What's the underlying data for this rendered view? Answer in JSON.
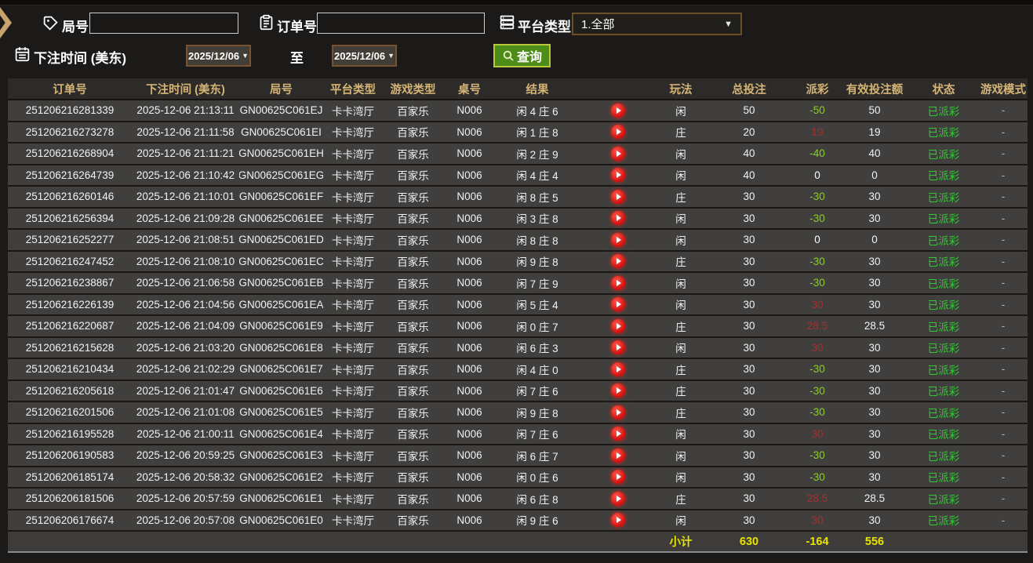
{
  "filters": {
    "game_no_label": "局号",
    "game_no_value": "",
    "order_no_label": "订单号",
    "order_no_value": "",
    "platform_type_label": "平台类型",
    "platform_type_value": "1.全部",
    "bet_time_label": "下注时间 (美东)",
    "date_from": "2025/12/06",
    "to_label": "至",
    "date_to": "2025/12/06",
    "query_label": "查询"
  },
  "colors": {
    "header_gold": "#d6b476",
    "payout_negative_green": "#8bd02a",
    "payout_positive_red": "#a42f2f",
    "status_green": "#2ecc31",
    "subtotal_yellow": "#e8e400",
    "query_button_green": "#4e8c1a",
    "play_button_red": "#d40d0d"
  },
  "table": {
    "headers": [
      "订单号",
      "下注时间 (美东)",
      "局号",
      "平台类型",
      "游戏类型",
      "桌号",
      "结果",
      "",
      "玩法",
      "总投注",
      "派彩",
      "有效投注额",
      "状态",
      "游戏模式"
    ],
    "rows": [
      {
        "order": "251206216281339",
        "time": "2025-12-06 21:13:11",
        "game": "GN00625C061EJ",
        "platform": "卡卡湾厅",
        "game_type": "百家乐",
        "table_no": "N006",
        "result": "闲 4 庄 6",
        "play": "闲",
        "bet": "50",
        "payout": "-50",
        "payout_state": "loss",
        "valid": "50",
        "status": "已派彩",
        "mode": "-"
      },
      {
        "order": "251206216273278",
        "time": "2025-12-06 21:11:58",
        "game": "GN00625C061EI",
        "platform": "卡卡湾厅",
        "game_type": "百家乐",
        "table_no": "N006",
        "result": "闲 1 庄 8",
        "play": "庄",
        "bet": "20",
        "payout": "19",
        "payout_state": "win",
        "valid": "19",
        "status": "已派彩",
        "mode": "-"
      },
      {
        "order": "251206216268904",
        "time": "2025-12-06 21:11:21",
        "game": "GN00625C061EH",
        "platform": "卡卡湾厅",
        "game_type": "百家乐",
        "table_no": "N006",
        "result": "闲 2 庄 9",
        "play": "闲",
        "bet": "40",
        "payout": "-40",
        "payout_state": "loss",
        "valid": "40",
        "status": "已派彩",
        "mode": "-"
      },
      {
        "order": "251206216264739",
        "time": "2025-12-06 21:10:42",
        "game": "GN00625C061EG",
        "platform": "卡卡湾厅",
        "game_type": "百家乐",
        "table_no": "N006",
        "result": "闲 4 庄 4",
        "play": "闲",
        "bet": "40",
        "payout": "0",
        "payout_state": "even",
        "valid": "0",
        "status": "已派彩",
        "mode": "-"
      },
      {
        "order": "251206216260146",
        "time": "2025-12-06 21:10:01",
        "game": "GN00625C061EF",
        "platform": "卡卡湾厅",
        "game_type": "百家乐",
        "table_no": "N006",
        "result": "闲 8 庄 5",
        "play": "庄",
        "bet": "30",
        "payout": "-30",
        "payout_state": "loss",
        "valid": "30",
        "status": "已派彩",
        "mode": "-"
      },
      {
        "order": "251206216256394",
        "time": "2025-12-06 21:09:28",
        "game": "GN00625C061EE",
        "platform": "卡卡湾厅",
        "game_type": "百家乐",
        "table_no": "N006",
        "result": "闲 3 庄 8",
        "play": "闲",
        "bet": "30",
        "payout": "-30",
        "payout_state": "loss",
        "valid": "30",
        "status": "已派彩",
        "mode": "-"
      },
      {
        "order": "251206216252277",
        "time": "2025-12-06 21:08:51",
        "game": "GN00625C061ED",
        "platform": "卡卡湾厅",
        "game_type": "百家乐",
        "table_no": "N006",
        "result": "闲 8 庄 8",
        "play": "闲",
        "bet": "30",
        "payout": "0",
        "payout_state": "even",
        "valid": "0",
        "status": "已派彩",
        "mode": "-"
      },
      {
        "order": "251206216247452",
        "time": "2025-12-06 21:08:10",
        "game": "GN00625C061EC",
        "platform": "卡卡湾厅",
        "game_type": "百家乐",
        "table_no": "N006",
        "result": "闲 9 庄 8",
        "play": "庄",
        "bet": "30",
        "payout": "-30",
        "payout_state": "loss",
        "valid": "30",
        "status": "已派彩",
        "mode": "-"
      },
      {
        "order": "251206216238867",
        "time": "2025-12-06 21:06:58",
        "game": "GN00625C061EB",
        "platform": "卡卡湾厅",
        "game_type": "百家乐",
        "table_no": "N006",
        "result": "闲 7 庄 9",
        "play": "闲",
        "bet": "30",
        "payout": "-30",
        "payout_state": "loss",
        "valid": "30",
        "status": "已派彩",
        "mode": "-"
      },
      {
        "order": "251206216226139",
        "time": "2025-12-06 21:04:56",
        "game": "GN00625C061EA",
        "platform": "卡卡湾厅",
        "game_type": "百家乐",
        "table_no": "N006",
        "result": "闲 5 庄 4",
        "play": "闲",
        "bet": "30",
        "payout": "30",
        "payout_state": "win",
        "valid": "30",
        "status": "已派彩",
        "mode": "-"
      },
      {
        "order": "251206216220687",
        "time": "2025-12-06 21:04:09",
        "game": "GN00625C061E9",
        "platform": "卡卡湾厅",
        "game_type": "百家乐",
        "table_no": "N006",
        "result": "闲 0 庄 7",
        "play": "庄",
        "bet": "30",
        "payout": "28.5",
        "payout_state": "win",
        "valid": "28.5",
        "status": "已派彩",
        "mode": "-"
      },
      {
        "order": "251206216215628",
        "time": "2025-12-06 21:03:20",
        "game": "GN00625C061E8",
        "platform": "卡卡湾厅",
        "game_type": "百家乐",
        "table_no": "N006",
        "result": "闲 6 庄 3",
        "play": "闲",
        "bet": "30",
        "payout": "30",
        "payout_state": "win",
        "valid": "30",
        "status": "已派彩",
        "mode": "-"
      },
      {
        "order": "251206216210434",
        "time": "2025-12-06 21:02:29",
        "game": "GN00625C061E7",
        "platform": "卡卡湾厅",
        "game_type": "百家乐",
        "table_no": "N006",
        "result": "闲 4 庄 0",
        "play": "庄",
        "bet": "30",
        "payout": "-30",
        "payout_state": "loss",
        "valid": "30",
        "status": "已派彩",
        "mode": "-"
      },
      {
        "order": "251206216205618",
        "time": "2025-12-06 21:01:47",
        "game": "GN00625C061E6",
        "platform": "卡卡湾厅",
        "game_type": "百家乐",
        "table_no": "N006",
        "result": "闲 7 庄 6",
        "play": "庄",
        "bet": "30",
        "payout": "-30",
        "payout_state": "loss",
        "valid": "30",
        "status": "已派彩",
        "mode": "-"
      },
      {
        "order": "251206216201506",
        "time": "2025-12-06 21:01:08",
        "game": "GN00625C061E5",
        "platform": "卡卡湾厅",
        "game_type": "百家乐",
        "table_no": "N006",
        "result": "闲 9 庄 8",
        "play": "庄",
        "bet": "30",
        "payout": "-30",
        "payout_state": "loss",
        "valid": "30",
        "status": "已派彩",
        "mode": "-"
      },
      {
        "order": "251206216195528",
        "time": "2025-12-06 21:00:11",
        "game": "GN00625C061E4",
        "platform": "卡卡湾厅",
        "game_type": "百家乐",
        "table_no": "N006",
        "result": "闲 7 庄 6",
        "play": "闲",
        "bet": "30",
        "payout": "30",
        "payout_state": "win",
        "valid": "30",
        "status": "已派彩",
        "mode": "-"
      },
      {
        "order": "251206206190583",
        "time": "2025-12-06 20:59:25",
        "game": "GN00625C061E3",
        "platform": "卡卡湾厅",
        "game_type": "百家乐",
        "table_no": "N006",
        "result": "闲 6 庄 7",
        "play": "闲",
        "bet": "30",
        "payout": "-30",
        "payout_state": "loss",
        "valid": "30",
        "status": "已派彩",
        "mode": "-"
      },
      {
        "order": "251206206185174",
        "time": "2025-12-06 20:58:32",
        "game": "GN00625C061E2",
        "platform": "卡卡湾厅",
        "game_type": "百家乐",
        "table_no": "N006",
        "result": "闲 0 庄 6",
        "play": "闲",
        "bet": "30",
        "payout": "-30",
        "payout_state": "loss",
        "valid": "30",
        "status": "已派彩",
        "mode": "-"
      },
      {
        "order": "251206206181506",
        "time": "2025-12-06 20:57:59",
        "game": "GN00625C061E1",
        "platform": "卡卡湾厅",
        "game_type": "百家乐",
        "table_no": "N006",
        "result": "闲 6 庄 8",
        "play": "庄",
        "bet": "30",
        "payout": "28.5",
        "payout_state": "win",
        "valid": "28.5",
        "status": "已派彩",
        "mode": "-"
      },
      {
        "order": "251206206176674",
        "time": "2025-12-06 20:57:08",
        "game": "GN00625C061E0",
        "platform": "卡卡湾厅",
        "game_type": "百家乐",
        "table_no": "N006",
        "result": "闲 9 庄 6",
        "play": "闲",
        "bet": "30",
        "payout": "30",
        "payout_state": "win",
        "valid": "30",
        "status": "已派彩",
        "mode": "-"
      }
    ],
    "subtotal": {
      "label": "小计",
      "total_bet": "630",
      "payout": "-164",
      "valid_bet": "556"
    }
  }
}
